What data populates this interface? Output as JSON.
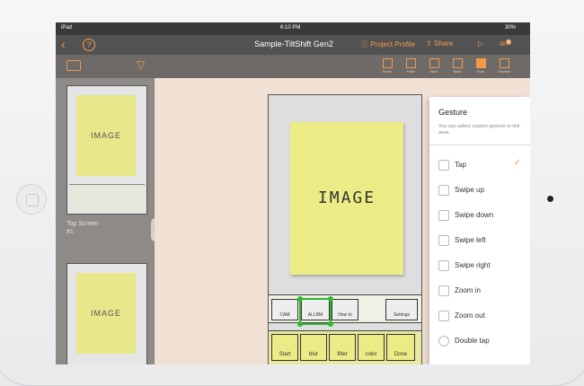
{
  "status": {
    "carrier": "iPad",
    "time": "6:10 PM",
    "battery": "30%"
  },
  "topbar": {
    "back_icon": "chevron-left-icon",
    "help_label": "?",
    "title": "Sample-TiltShift Gen2",
    "project_profile": "Project Profile",
    "share": "Share",
    "badge": "8"
  },
  "toolbar": {
    "tools": [
      {
        "label": "Home"
      },
      {
        "label": "Fade"
      },
      {
        "label": "Next"
      },
      {
        "label": "Back"
      },
      {
        "label": "Rule"
      },
      {
        "label": "Dismiss"
      }
    ]
  },
  "sidebar": {
    "thumb_text": "IMAGE",
    "screen_name": "Top Screen",
    "screen_number": "#1",
    "handle_label": "|||"
  },
  "canvas": {
    "note_text": "IMAGE",
    "bar1": [
      "CAM",
      "ALLBM",
      "How to",
      "Settings"
    ],
    "bar2": [
      "Start",
      "blur",
      "filter",
      "color",
      "Done"
    ]
  },
  "gesture_panel": {
    "title": "Gesture",
    "description": "You can select custom gesture to link area.",
    "check_mark": "✓",
    "options": [
      {
        "label": "Tap",
        "selected": true
      },
      {
        "label": "Swipe up",
        "selected": false
      },
      {
        "label": "Swipe down",
        "selected": false
      },
      {
        "label": "Swipe left",
        "selected": false
      },
      {
        "label": "Swipe right",
        "selected": false
      },
      {
        "label": "Zoom in",
        "selected": false
      },
      {
        "label": "Zoom out",
        "selected": false
      },
      {
        "label": "Double tap",
        "selected": false
      }
    ]
  },
  "colors": {
    "accent": "#f39a4a",
    "selection": "#2eb82e",
    "note": "#ecec86"
  }
}
